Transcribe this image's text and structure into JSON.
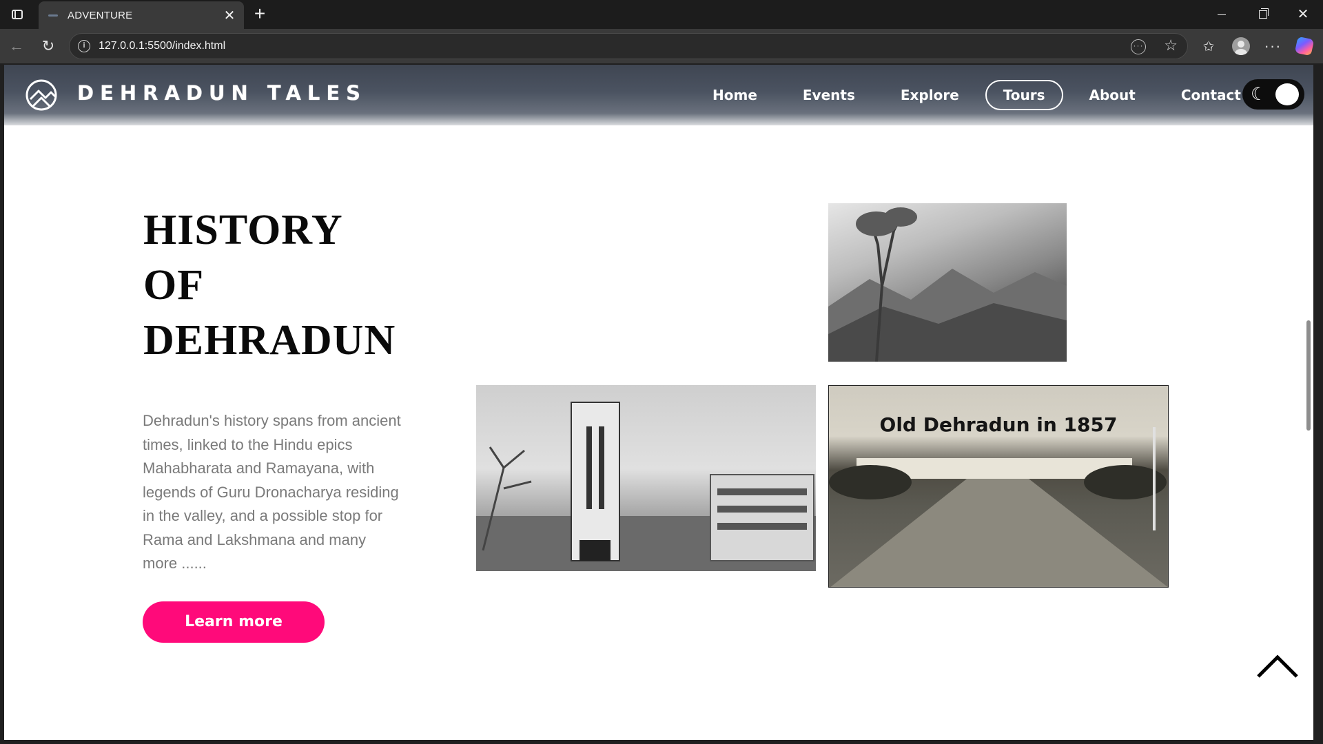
{
  "browser": {
    "tab_title": "ADVENTURE",
    "url": "127.0.0.1:5500/index.html"
  },
  "site": {
    "brand": "DEHRADUN TALES",
    "nav": [
      {
        "label": "Home",
        "active": false
      },
      {
        "label": "Events",
        "active": false
      },
      {
        "label": "Explore",
        "active": false
      },
      {
        "label": "Tours",
        "active": true
      },
      {
        "label": "About",
        "active": false
      },
      {
        "label": "Contact",
        "active": false
      }
    ],
    "theme_mode": "dark-toggle"
  },
  "section": {
    "heading_lines": [
      "HISTORY",
      "OF",
      "DEHRADUN"
    ],
    "description": "Dehradun's history spans from ancient times, linked to the Hindu epics Mahabharata and Ramayana, with legends of Guru Dronacharya residing in the valley, and a possible stop for Rama and Lakshmana and many more ......",
    "button_label": "Learn more",
    "images": {
      "old_caption": "Old Dehradun in 1857"
    }
  },
  "colors": {
    "accent": "#ff0a7a",
    "heading": "#0a0a0a",
    "body_text": "#7a7a7a"
  }
}
